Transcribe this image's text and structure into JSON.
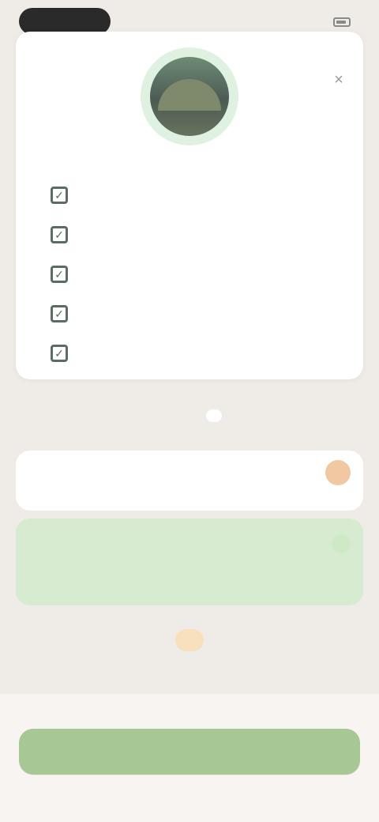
{
  "status_bar": {
    "left_pill_label": "",
    "right_text": ""
  },
  "header": {
    "subtitle": ""
  },
  "features": [
    {
      "label": ""
    },
    {
      "label": ""
    },
    {
      "label": ""
    },
    {
      "label": ""
    },
    {
      "label": ""
    }
  ],
  "billing_toggle": {
    "options": [
      {
        "label": "",
        "active": false
      },
      {
        "label": "",
        "active": true
      }
    ]
  },
  "plans": {
    "month": {
      "label": "",
      "price": "",
      "badge": ""
    },
    "year": {
      "label": "",
      "price": "",
      "badge": ""
    }
  },
  "promo": {
    "badge": "",
    "note": ""
  },
  "legal": {
    "text": ""
  },
  "cta": {
    "label": ""
  },
  "icons": {
    "close": "close-icon",
    "check": "check-icon",
    "battery": "battery-icon"
  },
  "colors": {
    "background": "#efebe6",
    "card": "#ffffff",
    "accent_green": "#a7c794",
    "badge_orange": "#f1c8a2",
    "selected_plan_bg": "#d6ebd0"
  }
}
